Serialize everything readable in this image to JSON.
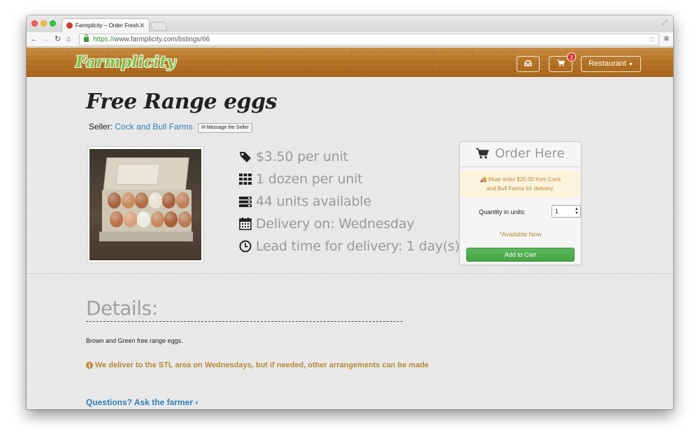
{
  "browser": {
    "tab_title": "Farmplicity – Order Fresh…",
    "url_scheme": "https://",
    "url_rest": "www.farmplicity.com/listings/66"
  },
  "site": {
    "logo_text": "Farmplicity",
    "cart_count": "3",
    "account_menu_label": "Restaurant"
  },
  "listing": {
    "title": "Free Range eggs",
    "seller_prefix": "Seller:",
    "seller_name": "Cock and Bull Farms",
    "message_button": "Message the Seller",
    "info": [
      {
        "icon": "tag-icon",
        "text": "$3.50 per unit"
      },
      {
        "icon": "grid-icon",
        "text": "1 dozen per unit"
      },
      {
        "icon": "stack-icon",
        "text": "44 units available"
      },
      {
        "icon": "calendar-icon",
        "text": "Delivery on: Wednesday"
      },
      {
        "icon": "clock-icon",
        "text": "Lead time for delivery: 1 day(s)"
      }
    ]
  },
  "order": {
    "heading": "Order Here",
    "warning_line1": "Must order $20.00 from Cock",
    "warning_line2": "and Bull Farms for delivery.",
    "quantity_label": "Quantity in units:",
    "quantity_value": "1",
    "availability": "*Available Now",
    "add_to_cart": "Add to Cart"
  },
  "details": {
    "heading": "Details:",
    "description": "Brown and Green free range eggs.",
    "notice": "We deliver to the STL area on Wednesdays, but if needed, other arrangements can be made",
    "questions_link": "Questions? Ask the farmer"
  },
  "colors": {
    "link": "#2f7fb8",
    "notice": "#b78a35",
    "success": "#5cb85c",
    "badge": "#d9302c"
  }
}
